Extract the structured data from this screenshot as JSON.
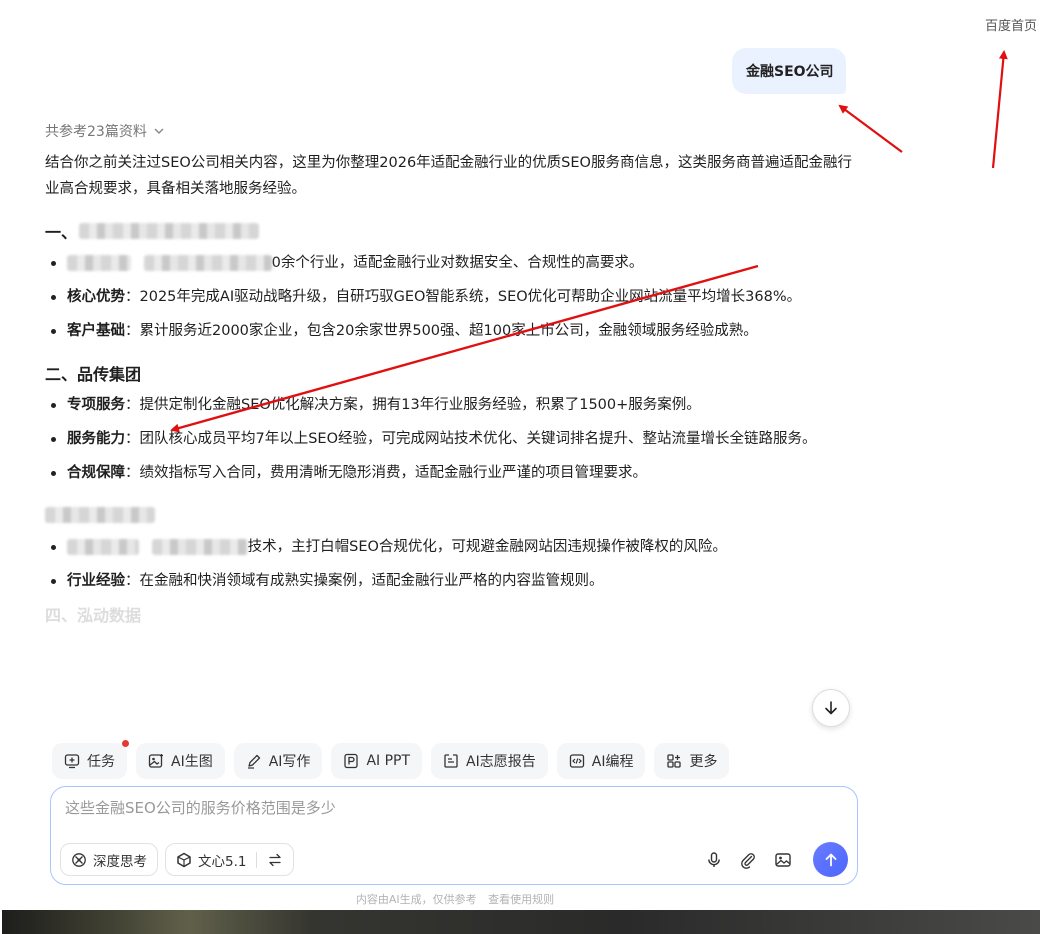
{
  "header": {
    "home_link": "百度首页"
  },
  "query": "金融SEO公司",
  "answer": {
    "refs_label": "共参考23篇资料",
    "intro": "结合你之前关注过SEO公司相关内容，这里为你整理2026年适配金融行业的优质SEO服务商信息，这类服务商普遍适配金融行业高合规要求，具备相关落地服务经验。",
    "section1": {
      "title_prefix": "一、",
      "item1_tail": "0余个行业，适配金融行业对数据安全、合规性的高要求。",
      "item2_label": "核心优势",
      "item2_text": "：2025年完成AI驱动战略升级，自研巧驭GEO智能系统，SEO优化可帮助企业网站流量平均增长368%。",
      "item3_label": "客户基础",
      "item3_text": "：累计服务近2000家企业，包含20余家世界500强、超100家上市公司，金融领域服务经验成熟。"
    },
    "section2": {
      "title": "二、品传集团",
      "item1_label": "专项服务",
      "item1_text": "：提供定制化金融SEO优化解决方案，拥有13年行业服务经验，积累了1500+服务案例。",
      "item2_label": "服务能力",
      "item2_text": "：团队核心成员平均7年以上SEO经验，可完成网站技术优化、关键词排名提升、整站流量增长全链路服务。",
      "item3_label": "合规保障",
      "item3_text": "：绩效指标写入合同，费用清晰无隐形消费，适配金融行业严谨的项目管理要求。"
    },
    "section3": {
      "item1_tail": "技术，主打白帽SEO合规优化，可规避金融网站因违规操作被降权的风险。",
      "item2_label": "行业经验",
      "item2_text": "：在金融和快消领域有成熟实操案例，适配金融行业严格的内容监管规则。"
    },
    "section4_faded": "四、泓动数据"
  },
  "toolbar": {
    "tools": [
      "任务",
      "AI生图",
      "AI写作",
      "AI PPT",
      "AI志愿报告",
      "AI编程",
      "更多"
    ]
  },
  "composer": {
    "input_value": "这些金融SEO公司的服务价格范围是多少",
    "deep_think": "深度思考",
    "model": "文心5.1"
  },
  "footer": {
    "disclaimer": "内容由AI生成，仅供参考",
    "rules_link": "查看使用规则"
  },
  "colors": {
    "accent": "#4b66ff",
    "annotation_arrow": "#e01010",
    "user_bubble": "#eaf1ff"
  }
}
